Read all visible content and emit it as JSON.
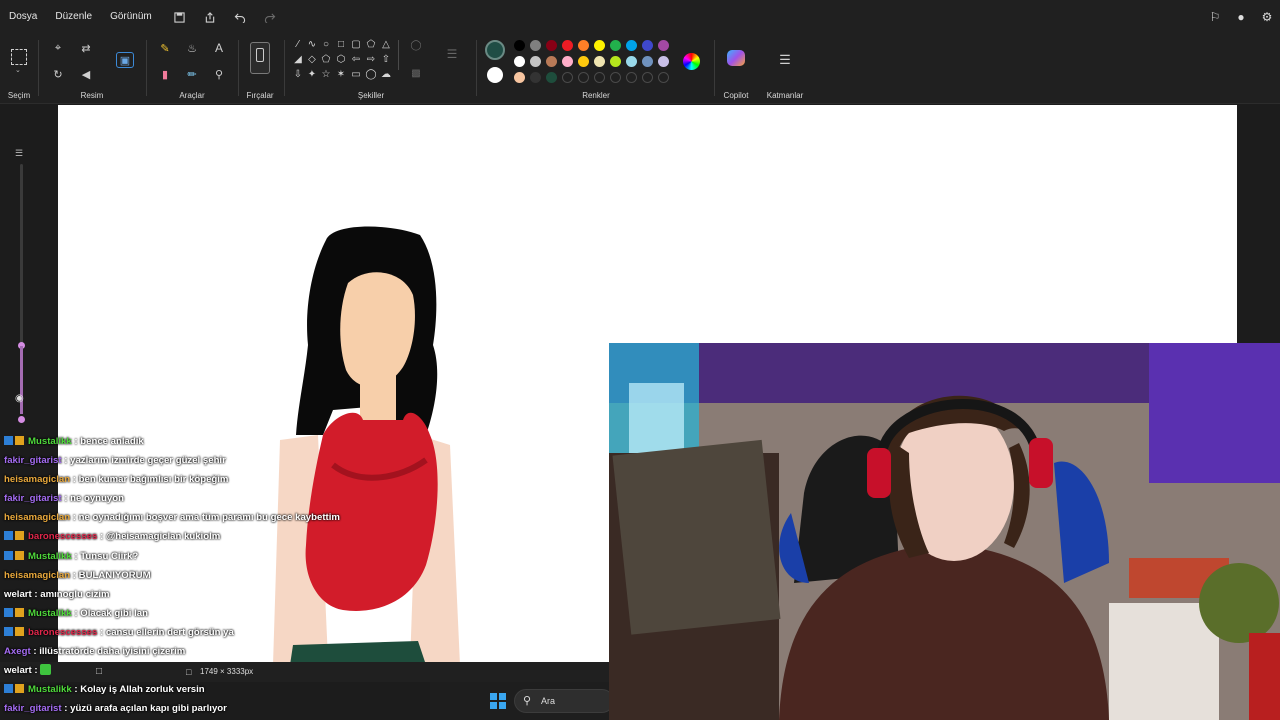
{
  "menu": {
    "file": "Dosya",
    "edit": "Düzenle",
    "view": "Görünüm"
  },
  "ribbon": {
    "selection": "Seçim",
    "image": "Resim",
    "tools": "Araçlar",
    "brushes": "Fırçalar",
    "shapes": "Şekiller",
    "colors": "Renkler",
    "copilot": "Copilot",
    "layers": "Katmanlar"
  },
  "colors": {
    "primary": "#1f4d45",
    "secondary": "#ffffff",
    "row1": [
      "#000000",
      "#7f7f7f",
      "#880015",
      "#ed1c24",
      "#ff7f27",
      "#fff200",
      "#22b14c",
      "#00a2e8",
      "#3f48cc",
      "#a349a4"
    ],
    "row2": [
      "#ffffff",
      "#c3c3c3",
      "#b97a57",
      "#ffaec9",
      "#ffc90e",
      "#efe4b0",
      "#b5e61d",
      "#99d9ea",
      "#7092be",
      "#c8bfe7"
    ],
    "row3": [
      "#f7c5a0",
      "#333333",
      "#1e4d3c",
      "",
      "",
      "",
      "",
      "",
      "",
      ""
    ]
  },
  "status": {
    "dimensions": "1749 × 3333px"
  },
  "taskbar": {
    "search": "Ara"
  },
  "chat": [
    {
      "user": "Mustalikk",
      "color": "#4fd93b",
      "badges": true,
      "text": "bence anladık"
    },
    {
      "user": "fakir_gitarist",
      "color": "#a46cf2",
      "badges": false,
      "text": "yazlarım izmirde geçer güzel şehir"
    },
    {
      "user": "heisamagiclan",
      "color": "#e8a83c",
      "badges": false,
      "text": "ben kumar bağımlısı bir köpeğim"
    },
    {
      "user": "fakir_gitarist",
      "color": "#a46cf2",
      "badges": false,
      "text": "ne oynuyon"
    },
    {
      "user": "heisamagiclan",
      "color": "#e8a83c",
      "badges": false,
      "text": "ne oynadığımı boşver ama tüm paramı bu gece kaybettim"
    },
    {
      "user": "baronescesses",
      "color": "#e0264a",
      "badges": true,
      "text": "@heisamagiclan kukiolm"
    },
    {
      "user": "Mustalikk",
      "color": "#4fd93b",
      "badges": true,
      "text": "Tunsu Ciirk?"
    },
    {
      "user": "heisamagiclan",
      "color": "#e8a83c",
      "badges": false,
      "text": "BULANIYORUM"
    },
    {
      "user": "welart",
      "color": "#ffffff",
      "badges": false,
      "text": "amınoglu cizim"
    },
    {
      "user": "Mustalikk",
      "color": "#4fd93b",
      "badges": true,
      "text": "Olacak gibi lan"
    },
    {
      "user": "baronescesses",
      "color": "#e0264a",
      "badges": true,
      "text": "cansu ellerin dert görsün ya"
    },
    {
      "user": "Axegt",
      "color": "#a46cf2",
      "badges": false,
      "text": "illüstratörde daha iyisini çizerim"
    },
    {
      "user": "welart",
      "color": "#ffffff",
      "badges": false,
      "text": ""
    },
    {
      "user": "Mustalikk",
      "color": "#4fd93b",
      "badges": true,
      "text": "Kolay iş Allah zorluk versin"
    },
    {
      "user": "fakir_gitarist",
      "color": "#a46cf2",
      "badges": false,
      "text": "yüzü arafa açılan kapı gibi parlıyor"
    }
  ]
}
